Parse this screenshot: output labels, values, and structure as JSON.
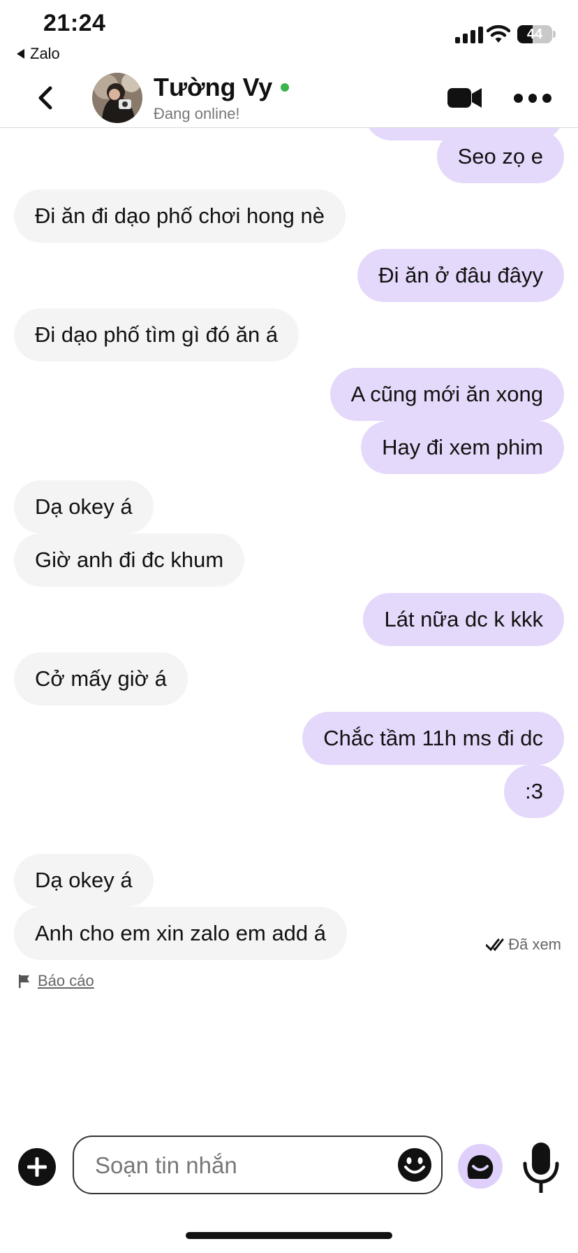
{
  "status_bar": {
    "time": "21:24",
    "back_app": "Zalo",
    "battery": "44",
    "battery_level": 0.44
  },
  "header": {
    "name": "Tường Vy",
    "status": "Đang online!",
    "online_color": "#3cb44b"
  },
  "messages": [
    {
      "dir": "out",
      "text": "Seo zọ e"
    },
    {
      "dir": "in",
      "text": "Đi ăn đi dạo phố chơi hong nè"
    },
    {
      "dir": "out",
      "text": "Đi ăn ở đâu đâyy"
    },
    {
      "dir": "in",
      "text": "Đi dạo phố tìm gì đó ăn á"
    },
    {
      "dir": "out",
      "text": "A cũng mới ăn xong"
    },
    {
      "dir": "out",
      "text": "Hay đi xem phim"
    },
    {
      "dir": "in",
      "text": "Dạ okey á"
    },
    {
      "dir": "in",
      "text": "Giờ anh đi đc khum"
    },
    {
      "dir": "out",
      "text": "Lát nữa dc k kkk"
    },
    {
      "dir": "in",
      "text": "Cở mấy giờ á"
    },
    {
      "dir": "out",
      "text": "Chắc tầm 11h ms đi dc"
    },
    {
      "dir": "out",
      "text": ":3"
    },
    {
      "dir": "in",
      "text": "Dạ okey á"
    },
    {
      "dir": "in",
      "text": "Anh cho em xin zalo em add á"
    }
  ],
  "seen_label": "Đã xem",
  "report_label": "Báo cáo",
  "composer": {
    "placeholder": "Soạn tin nhắn"
  },
  "colors": {
    "outgoing_bubble": "#e5d9fb",
    "incoming_bubble": "#f4f4f4",
    "sticker_button": "#dfd0fb"
  }
}
